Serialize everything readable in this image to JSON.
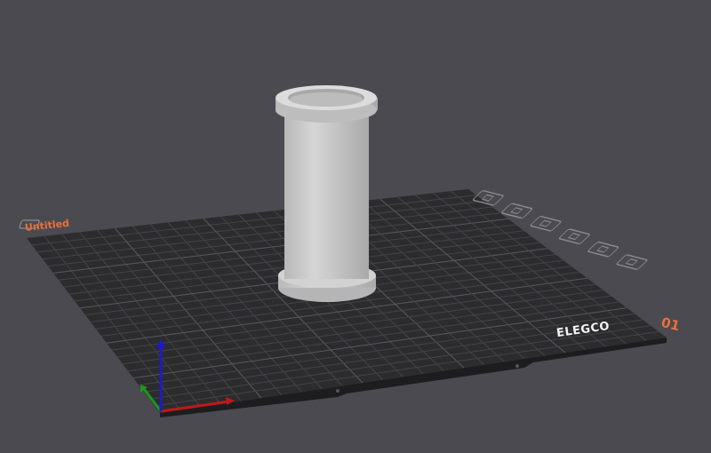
{
  "plate": {
    "name": "Untitled",
    "index": "01",
    "brand": "ELEGCO",
    "grid_divisions": 25
  },
  "plate_toolbar": [
    {
      "icon": "close-icon"
    },
    {
      "icon": "orient-icon"
    },
    {
      "icon": "arrange-icon"
    },
    {
      "icon": "lock-icon"
    },
    {
      "icon": "settings-icon"
    },
    {
      "icon": "move-icon"
    }
  ],
  "colors": {
    "background": "#4b4a50",
    "plate": "#2c2c2e",
    "grid": "#4a4a4e",
    "accent": "#e9703a",
    "model": "#c8c8c8",
    "axis_x": "#c01818",
    "axis_y": "#1a9a1a",
    "axis_z": "#1a1acc"
  }
}
